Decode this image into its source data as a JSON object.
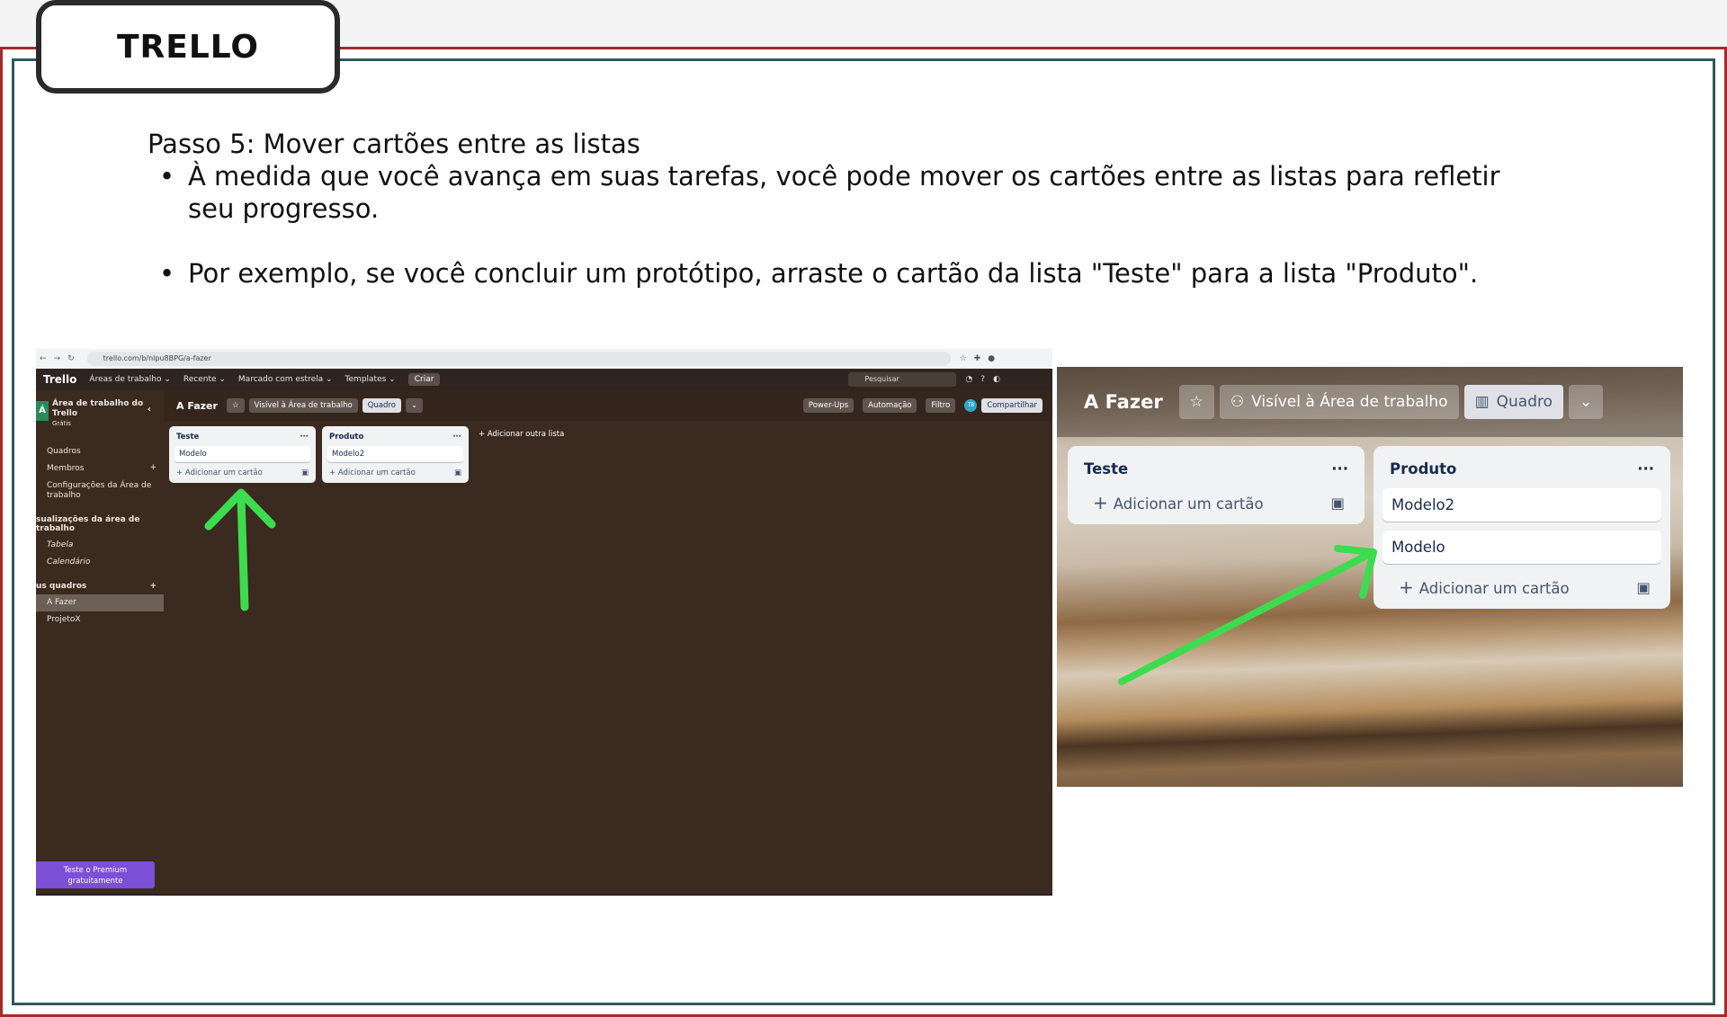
{
  "title": "TRELLO",
  "step": {
    "heading": "Passo 5: Mover cartões entre as listas",
    "bullets": [
      "À medida que você avança em suas tarefas, você pode mover os cartões entre as listas para refletir seu progresso.",
      "Por exemplo, se você  concluir um protótipo, arraste o cartão da lista \"Teste\" para a lista \"Produto\"."
    ]
  },
  "shot1": {
    "url": "trello.com/b/nlpu8BPG/a-fazer",
    "nav": {
      "logo": "Trello",
      "items": [
        "Áreas de trabalho ⌄",
        "Recente ⌄",
        "Marcado com estrela ⌄",
        "Templates ⌄"
      ],
      "create": "Criar",
      "search": "Pesquisar"
    },
    "sidebar": {
      "workspace_avatar": "Á",
      "workspace_name": "Área de trabalho do Trello",
      "workspace_plan": "Grátis",
      "items": [
        "Quadros",
        "Membros",
        "Configurações da Área de trabalho"
      ],
      "views_heading": "sualizações da área de trabalho",
      "views": [
        "Tabela",
        "Calendário"
      ],
      "boards_heading": "us quadros",
      "boards": [
        "A Fazer",
        "ProjetoX"
      ],
      "premium": "Teste o Premium gratuitamente"
    },
    "board": {
      "title": "A Fazer",
      "visibility": "Visível à Área de trabalho",
      "view": "Quadro",
      "powerups": "Power-Ups",
      "automation": "Automação",
      "filter": "Filtro",
      "avatar": "TB",
      "share": "Compartilhar",
      "lists": [
        {
          "name": "Teste",
          "cards": [
            "Modelo"
          ],
          "add": "Adicionar um cartão"
        },
        {
          "name": "Produto",
          "cards": [
            "Modelo2"
          ],
          "add": "Adicionar um cartão"
        }
      ],
      "add_list": "Adicionar outra lista"
    }
  },
  "shot2": {
    "board_title": "A Fazer",
    "visibility": "Visível à Área de trabalho",
    "view": "Quadro",
    "lists": [
      {
        "name": "Teste",
        "cards": [],
        "add": "Adicionar um cartão"
      },
      {
        "name": "Produto",
        "cards": [
          "Modelo2",
          "Modelo"
        ],
        "add": "Adicionar um cartão"
      }
    ]
  },
  "colors": {
    "frame_outer": "#a52a2a",
    "frame_inner": "#2e5a5a",
    "arrow": "#3ddc4e",
    "premium": "#7b4fd6"
  }
}
